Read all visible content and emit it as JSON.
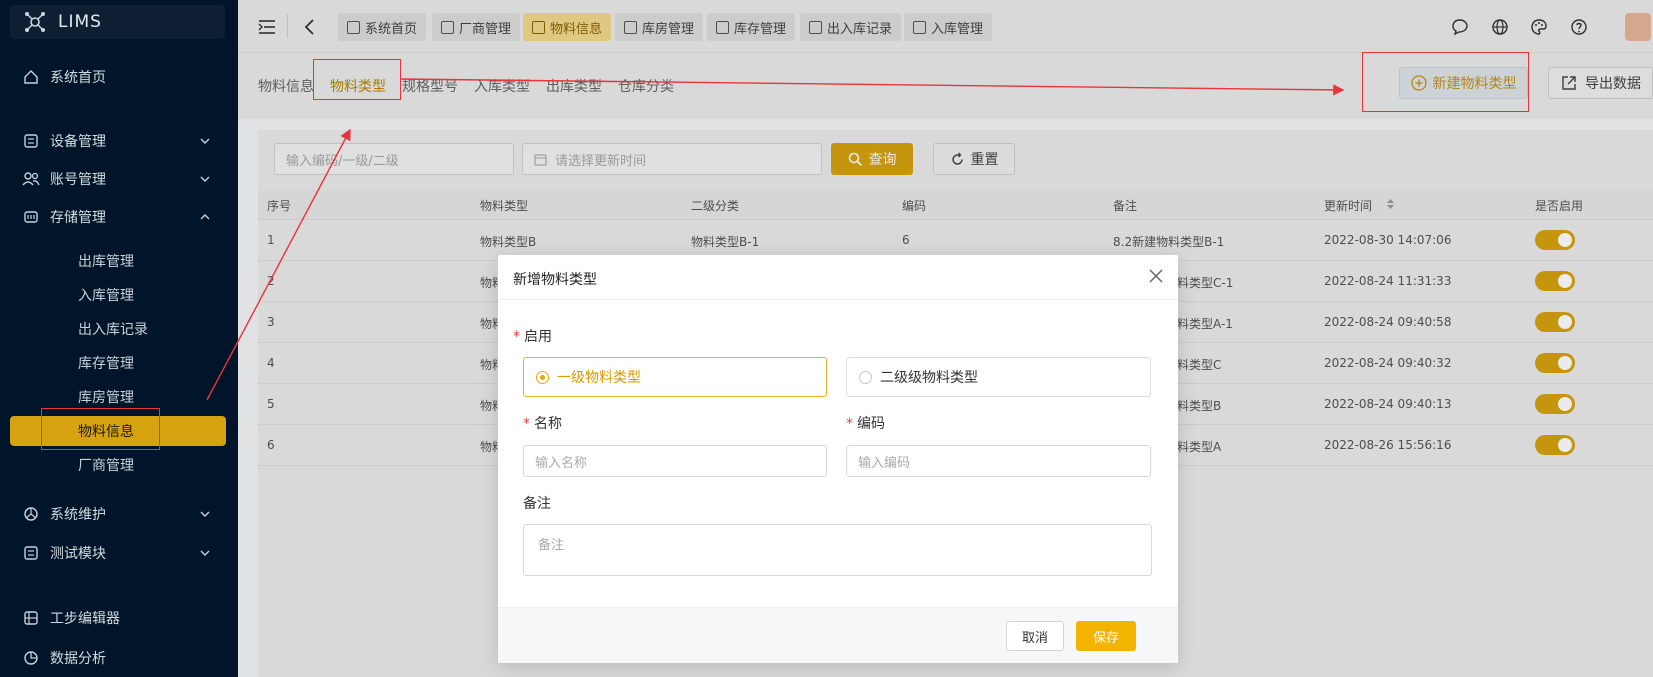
{
  "app": {
    "name": "LIMS"
  },
  "sidebar": {
    "items": [
      {
        "label": "系统首页",
        "icon": "home-icon"
      },
      {
        "label": "设备管理",
        "icon": "device-icon"
      },
      {
        "label": "账号管理",
        "icon": "users-icon"
      },
      {
        "label": "存储管理",
        "icon": "storage-icon"
      },
      {
        "label": "系统维护",
        "icon": "maintenance-icon"
      },
      {
        "label": "测试模块",
        "icon": "test-icon"
      },
      {
        "label": "工步编辑器",
        "icon": "grid-icon"
      },
      {
        "label": "数据分析",
        "icon": "analysis-icon"
      }
    ],
    "sub_items": [
      "出库管理",
      "入库管理",
      "出入库记录",
      "库存管理",
      "库房管理",
      "物料信息",
      "厂商管理"
    ]
  },
  "tabs": [
    "系统首页",
    "厂商管理",
    "物料信息",
    "库房管理",
    "库存管理",
    "出入库记录",
    "入库管理"
  ],
  "subnav": [
    "物料信息",
    "物料类型",
    "规格型号",
    "入库类型",
    "出库类型",
    "仓库分类"
  ],
  "actions": {
    "new": "新建物料类型",
    "export": "导出数据"
  },
  "filters": {
    "code_placeholder": "输入编码/一级/二级",
    "time_placeholder": "请选择更新时间",
    "query": "查询",
    "reset": "重置"
  },
  "table": {
    "headers": [
      "序号",
      "物料类型",
      "二级分类",
      "编码",
      "备注",
      "更新时间",
      "是否启用"
    ],
    "rows": [
      {
        "no": "1",
        "type": "物料类型B",
        "sub": "物料类型B-1",
        "code": "6",
        "note": "8.2新建物料类型B-1",
        "time": "2022-08-30 14:07:06"
      },
      {
        "no": "2",
        "type": "物料",
        "sub": "",
        "code": "",
        "note": "料类型C-1",
        "time": "2022-08-24 11:31:33"
      },
      {
        "no": "3",
        "type": "物料",
        "sub": "",
        "code": "",
        "note": "料类型A-1",
        "time": "2022-08-24 09:40:58"
      },
      {
        "no": "4",
        "type": "物料",
        "sub": "",
        "code": "",
        "note": "料类型C",
        "time": "2022-08-24 09:40:32"
      },
      {
        "no": "5",
        "type": "物料",
        "sub": "",
        "code": "",
        "note": "料类型B",
        "time": "2022-08-24 09:40:13"
      },
      {
        "no": "6",
        "type": "物料",
        "sub": "",
        "code": "",
        "note": "料类型A",
        "time": "2022-08-26 15:56:16"
      }
    ]
  },
  "modal": {
    "title": "新增物料类型",
    "enable_label": "启用",
    "option1": "一级物料类型",
    "option2": "二级级物料类型",
    "name_label": "名称",
    "name_placeholder": "输入名称",
    "code_label": "编码",
    "code_placeholder": "输入编码",
    "note_label": "备注",
    "note_placeholder": "备注",
    "cancel": "取消",
    "save": "保存"
  },
  "colors": {
    "accent": "#d6a20f",
    "sidebar_bg": "#001529",
    "annotation": "#e8343a"
  }
}
